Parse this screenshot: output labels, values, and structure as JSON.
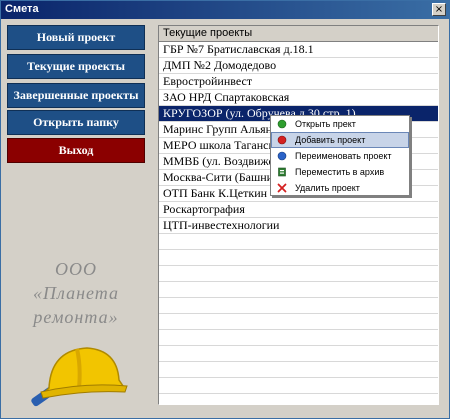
{
  "window": {
    "title": "Смета",
    "close_label": "×"
  },
  "sidebar": {
    "buttons": [
      {
        "label": "Новый проект"
      },
      {
        "label": "Текущие проекты"
      },
      {
        "label": "Завершенные проекты"
      },
      {
        "label": "Открыть папку"
      },
      {
        "label": "Выход"
      }
    ],
    "company_line1": "ООО",
    "company_line2": "«Планета",
    "company_line3": "ремонта»"
  },
  "list": {
    "header": "Текущие проекты",
    "rows": [
      "ГБР №7  Братиславская д.18.1",
      "ДМП №2 Домодедово",
      "Евростройинвест",
      "ЗАО НРД Спартаковская",
      "КРУГОЗОР (ул. Обручева д.30 стр. 1)",
      "Маринс Групп Альянс",
      "МЕРО школа Таганская",
      "ММВБ (ул. Воздвиженка",
      "Москва-Сити (Башни)",
      "ОТП Банк К.Цеткин",
      "Роскартография",
      "ЦТП-инвестехнологии"
    ],
    "selected_index": 4
  },
  "context_menu": {
    "items": [
      {
        "label": "Открыть прект",
        "icon": "green-dot-icon",
        "color": "#2e9e2e"
      },
      {
        "label": "Добавить проект",
        "icon": "red-dot-icon",
        "color": "#d42020"
      },
      {
        "label": "Переименовать проект",
        "icon": "blue-dot-icon",
        "color": "#2a62c8"
      },
      {
        "label": "Переместить в архив",
        "icon": "archive-icon",
        "color": "#2e7d32"
      },
      {
        "label": "Удалить проект",
        "icon": "delete-x-icon",
        "color": "#d42020"
      }
    ],
    "highlighted_index": 1
  }
}
